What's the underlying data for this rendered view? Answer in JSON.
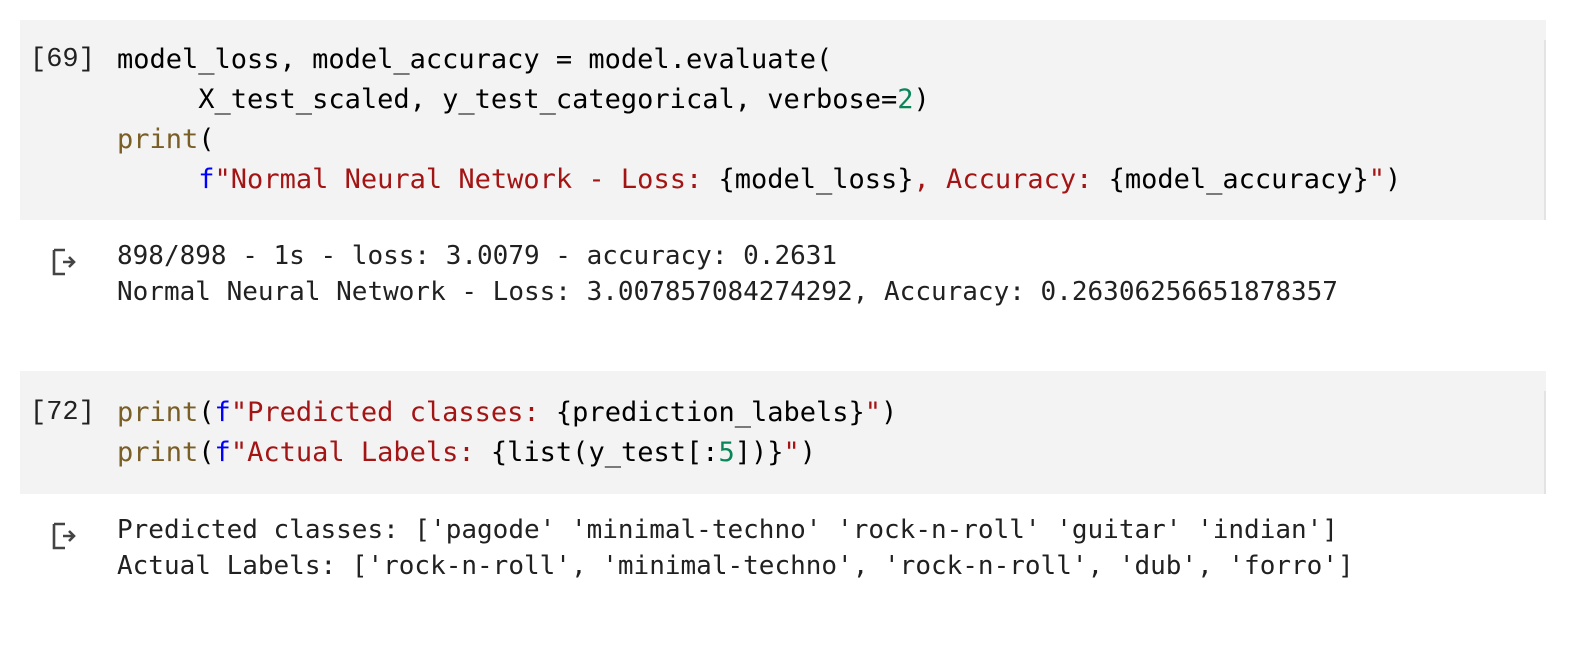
{
  "cells": [
    {
      "execution_count": "[69]",
      "code_lines": [
        [
          {
            "t": "plain",
            "v": "model_loss, model_accuracy = model.evaluate("
          }
        ],
        [
          {
            "t": "plain",
            "v": "     X_test_scaled, y_test_categorical, verbose="
          },
          {
            "t": "num",
            "v": "2"
          },
          {
            "t": "plain",
            "v": ")"
          }
        ],
        [
          {
            "t": "builtin",
            "v": "print"
          },
          {
            "t": "plain",
            "v": "("
          }
        ],
        [
          {
            "t": "plain",
            "v": "     "
          },
          {
            "t": "prefix",
            "v": "f"
          },
          {
            "t": "str",
            "v": "\"Normal Neural Network - Loss: "
          },
          {
            "t": "plain",
            "v": "{model_loss}"
          },
          {
            "t": "str",
            "v": ", Accuracy: "
          },
          {
            "t": "plain",
            "v": "{model_accuracy}"
          },
          {
            "t": "str",
            "v": "\""
          },
          {
            "t": "plain",
            "v": ")"
          }
        ]
      ],
      "output_icon": "output-arrow-icon",
      "output_lines": [
        "898/898 - 1s - loss: 3.0079 - accuracy: 0.2631",
        "Normal Neural Network - Loss: 3.007857084274292, Accuracy: 0.26306256651878357"
      ]
    },
    {
      "execution_count": "[72]",
      "code_lines": [
        [
          {
            "t": "builtin",
            "v": "print"
          },
          {
            "t": "plain",
            "v": "("
          },
          {
            "t": "prefix",
            "v": "f"
          },
          {
            "t": "str",
            "v": "\"Predicted classes: "
          },
          {
            "t": "plain",
            "v": "{prediction_labels}"
          },
          {
            "t": "str",
            "v": "\""
          },
          {
            "t": "plain",
            "v": ")"
          }
        ],
        [
          {
            "t": "builtin",
            "v": "print"
          },
          {
            "t": "plain",
            "v": "("
          },
          {
            "t": "prefix",
            "v": "f"
          },
          {
            "t": "str",
            "v": "\"Actual Labels: "
          },
          {
            "t": "plain",
            "v": "{list(y_test[:"
          },
          {
            "t": "num",
            "v": "5"
          },
          {
            "t": "plain",
            "v": "])}"
          },
          {
            "t": "str",
            "v": "\""
          },
          {
            "t": "plain",
            "v": ")"
          }
        ]
      ],
      "output_icon": "output-arrow-icon",
      "output_lines": [
        "Predicted classes: ['pagode' 'minimal-techno' 'rock-n-roll' 'guitar' 'indian']",
        "Actual Labels: ['rock-n-roll', 'minimal-techno', 'rock-n-roll', 'dub', 'forro']"
      ]
    }
  ],
  "colors": {
    "cell_background": "#f3f3f3",
    "builtin": "#795e26",
    "string": "#a31515",
    "f_prefix": "#0000ff",
    "number": "#098658"
  }
}
